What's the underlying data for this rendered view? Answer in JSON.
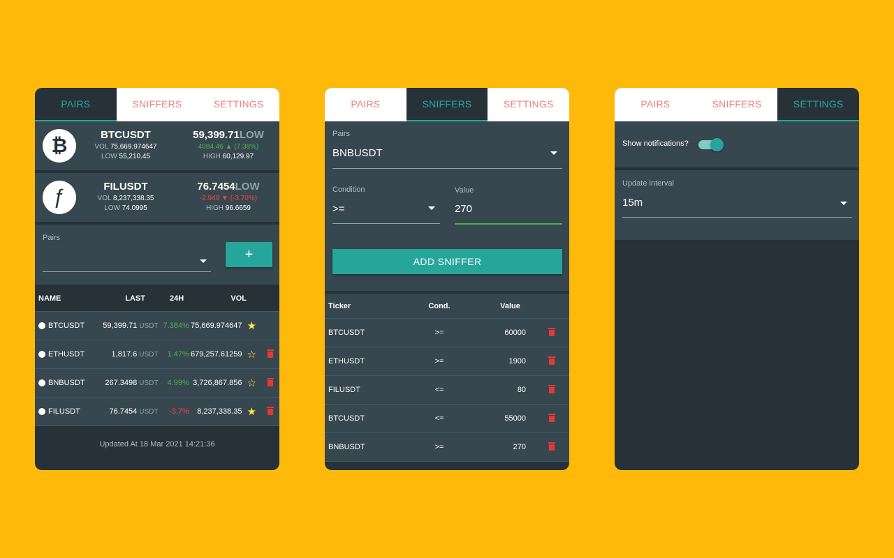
{
  "tabs": [
    "PAIRS",
    "SNIFFERS",
    "SETTINGS"
  ],
  "pairs_panel": {
    "tickers": [
      {
        "icon": "bitcoin-icon",
        "symbol": "₿",
        "name": "BTCUSDT",
        "price": "59,399.71",
        "low_word": "LOW",
        "vol_label": "VOL",
        "vol": "75,669.974647",
        "change": "4084.46 ▲ (7.38%)",
        "low_label": "LOW",
        "low": "55,210.45",
        "high_label": "HIGH",
        "high": "60,129.97",
        "direction": "up"
      },
      {
        "icon": "filecoin-icon",
        "symbol": "ƒ",
        "name": "FILUSDT",
        "price": "76.7454",
        "low_word": "LOW",
        "vol_label": "VOL",
        "vol": "8,237,338.35",
        "change": "-2.949 ▼ (-3.70%)",
        "low_label": "LOW",
        "low": "74.0995",
        "high_label": "HIGH",
        "high": "96.6659",
        "direction": "down"
      }
    ],
    "form": {
      "label": "Pairs",
      "value": "",
      "add_label": "+"
    },
    "table": {
      "headers": {
        "name": "NAME",
        "last": "LAST",
        "change": "24H",
        "vol": "VOL"
      },
      "rows": [
        {
          "name": "BTCUSDT",
          "last": "59,399.71",
          "unit": "USDT",
          "change": "7.384%",
          "vol": "75,669.974647",
          "star": "★",
          "deletable": false,
          "direction": "up"
        },
        {
          "name": "ETHUSDT",
          "last": "1,817.6",
          "unit": "USDT",
          "change": "1.47%",
          "vol": "679,257.61259",
          "star": "☆",
          "deletable": true,
          "direction": "up"
        },
        {
          "name": "BNBUSDT",
          "last": "267.3498",
          "unit": "USDT",
          "change": "4.99%",
          "vol": "3,726,867.856",
          "star": "☆",
          "deletable": true,
          "direction": "up"
        },
        {
          "name": "FILUSDT",
          "last": "76.7454",
          "unit": "USDT",
          "change": "-3.7%",
          "vol": "8,237,338.35",
          "star": "★",
          "deletable": true,
          "direction": "down"
        }
      ]
    },
    "updated": "Updated At 18 Mar 2021 14:21:36"
  },
  "sniffers_panel": {
    "pairs_label": "Pairs",
    "pairs_value": "BNBUSDT",
    "condition_label": "Condition",
    "condition_value": ">=",
    "value_label": "Value",
    "value_value": "270",
    "add_label": "ADD SNIFFER",
    "table": {
      "headers": {
        "ticker": "Ticker",
        "cond": "Cond.",
        "value": "Value"
      },
      "rows": [
        {
          "ticker": "BTCUSDT",
          "cond": ">=",
          "value": "60000"
        },
        {
          "ticker": "ETHUSDT",
          "cond": ">=",
          "value": "1900"
        },
        {
          "ticker": "FILUSDT",
          "cond": "<=",
          "value": "80"
        },
        {
          "ticker": "BTCUSDT",
          "cond": "<=",
          "value": "55000"
        },
        {
          "ticker": "BNBUSDT",
          "cond": ">=",
          "value": "270"
        }
      ]
    }
  },
  "settings_panel": {
    "notifications_label": "Show notifications?",
    "notifications_on": true,
    "interval_label": "Update interval",
    "interval_value": "15m"
  },
  "colors": {
    "background": "#FFB90A",
    "panel": "#263238",
    "card": "#37474F",
    "accent": "#26A69A",
    "tab_inactive": "#F08080",
    "up": "#4CAF50",
    "down": "#F44336",
    "star": "#FFEB3B"
  }
}
